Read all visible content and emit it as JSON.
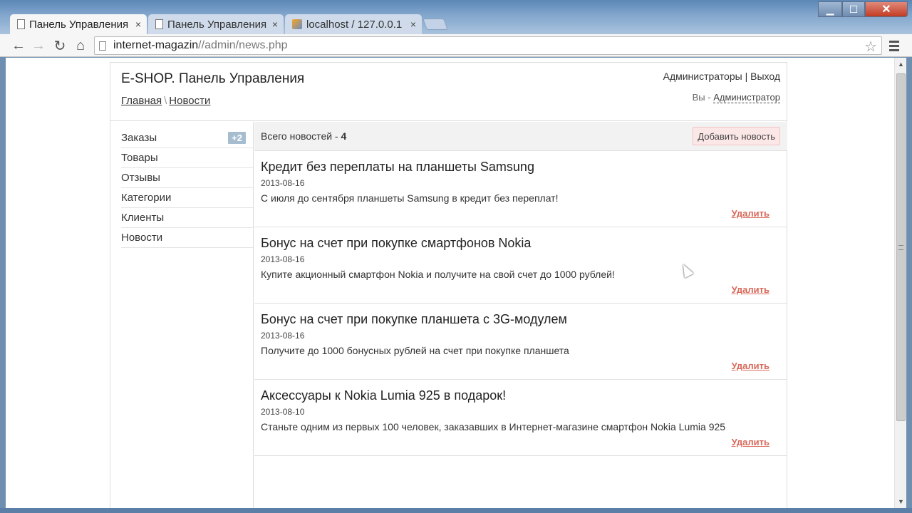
{
  "browser": {
    "tabs": [
      {
        "title": "Панель Управления",
        "active": true,
        "icon": "document-icon"
      },
      {
        "title": "Панель Управления",
        "active": false,
        "icon": "document-icon"
      },
      {
        "title": "localhost / 127.0.0.1",
        "active": false,
        "icon": "phpmyadmin-icon"
      }
    ],
    "url_host": "internet-magazin",
    "url_path": "//admin/news.php",
    "close_glyph": "×"
  },
  "header": {
    "site_title": "E-SHOP. Панель Управления",
    "breadcrumb_home": "Главная",
    "breadcrumb_sep": "\\",
    "breadcrumb_current": "Новости",
    "admins_link": "Администраторы",
    "nav_sep": "|",
    "logout_link": "Выход",
    "you_label": "Вы -",
    "role_link": "Администратор"
  },
  "sidebar": {
    "items": [
      {
        "label": "Заказы",
        "badge": "+2"
      },
      {
        "label": "Товары"
      },
      {
        "label": "Отзывы"
      },
      {
        "label": "Категории"
      },
      {
        "label": "Клиенты"
      },
      {
        "label": "Новости"
      }
    ]
  },
  "main": {
    "total_label": "Всего новостей - ",
    "total_count": "4",
    "add_button": "Добавить новость",
    "delete_label": "Удалить",
    "news": [
      {
        "title": "Кредит без переплаты на планшеты Samsung",
        "date": "2013-08-16",
        "text": "С июля до сентября планшеты Samsung в кредит без переплат!"
      },
      {
        "title": "Бонус на счет при покупке смартфонов Nokia",
        "date": "2013-08-16",
        "text": "Купите акционный смартфон Nokia и получите на свой счет до 1000 рублей!"
      },
      {
        "title": "Бонус на счет при покупке планшета с 3G-модулем",
        "date": "2013-08-16",
        "text": "Получите до 1000 бонусных рублей на счет при покупке планшета"
      },
      {
        "title": "Аксессуары к Nokia Lumia 925 в подарок!",
        "date": "2013-08-10",
        "text": "Станьте одним из первых 100 человек, заказавших в Интернет-магазине смартфон Nokia Lumia 925"
      }
    ]
  },
  "colors": {
    "badge": "#a6bdd0",
    "add_button_bg": "#fce7e7",
    "delete_link": "#d9695a",
    "content_head_bg": "#f2f2f2"
  }
}
